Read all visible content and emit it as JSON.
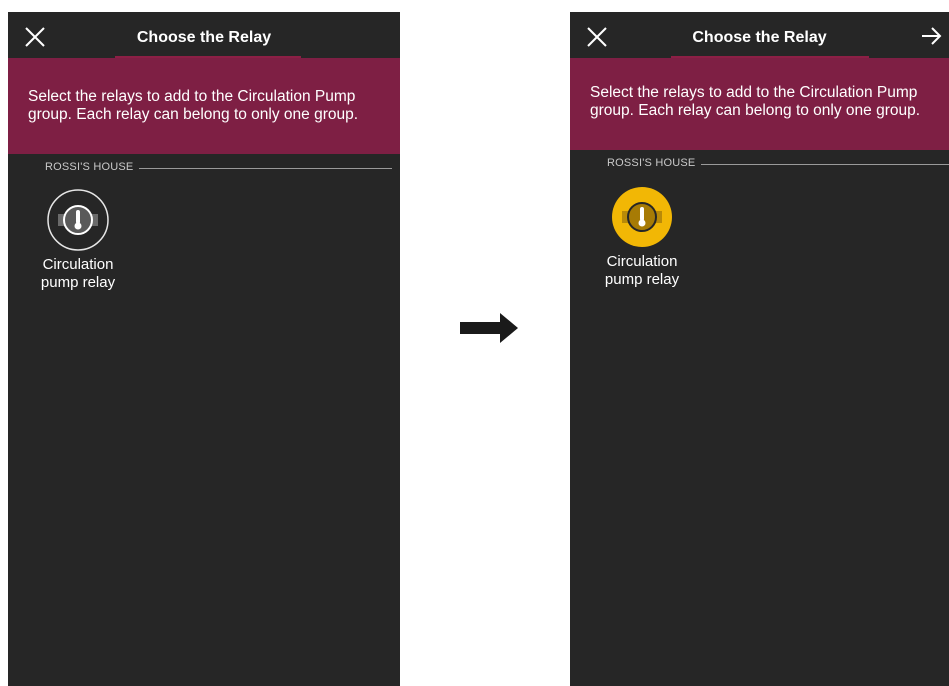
{
  "left_screen": {
    "header": {
      "title": "Choose the Relay",
      "close_icon": "close-icon"
    },
    "banner": {
      "message": "Select the relays to add to the Circulation Pump group. Each relay can belong to only one group."
    },
    "section": {
      "label": "ROSSI'S HOUSE"
    },
    "relay": {
      "name_line1": "Circulation",
      "name_line2": "pump relay",
      "icon": "thermometer-relay-icon",
      "selected": false
    }
  },
  "right_screen": {
    "header": {
      "title": "Choose the Relay",
      "close_icon": "close-icon",
      "next_icon": "arrow-right-icon"
    },
    "banner": {
      "message": "Select the relays to add to the Circulation Pump group. Each relay can belong to only one group."
    },
    "section": {
      "label": "ROSSI'S HOUSE"
    },
    "relay": {
      "name_line1": "Circulation",
      "name_line2": "pump relay",
      "icon": "thermometer-relay-icon",
      "selected": true
    }
  },
  "transition_icon": "right-arrow-icon",
  "colors": {
    "background": "#262626",
    "banner": "#7e1f44",
    "accent_underline": "#8c1f45",
    "selected": "#f2b705",
    "text": "#ffffff"
  }
}
